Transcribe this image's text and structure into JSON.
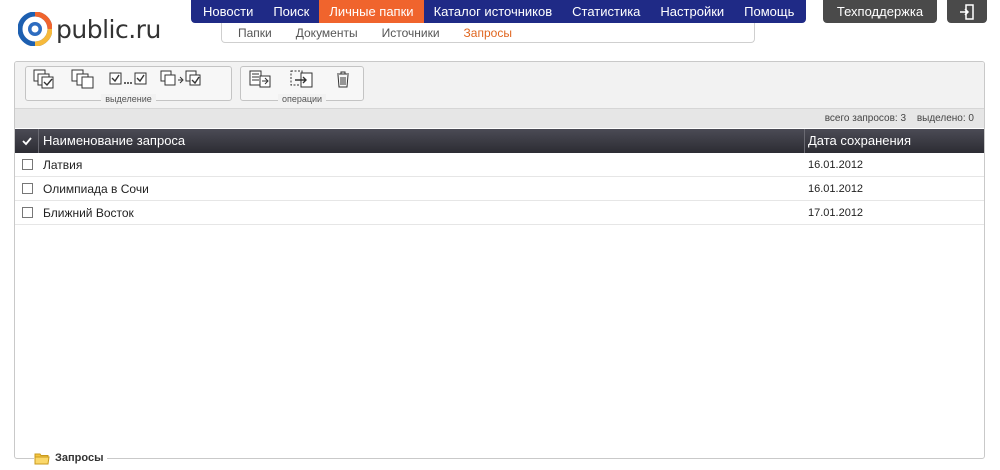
{
  "brand": {
    "name": "public.ru"
  },
  "main_nav": [
    {
      "label": "Новости"
    },
    {
      "label": "Поиск"
    },
    {
      "label": "Личные папки",
      "active": true
    },
    {
      "label": "Каталог источников"
    },
    {
      "label": "Статистика"
    },
    {
      "label": "Настройки"
    },
    {
      "label": "Помощь"
    }
  ],
  "support": {
    "label": "Техподдержка"
  },
  "sub_nav": [
    {
      "label": "Папки"
    },
    {
      "label": "Документы"
    },
    {
      "label": "Источники"
    },
    {
      "label": "Запросы",
      "active": true
    }
  ],
  "toolbar": {
    "selection_group_label": "выделение",
    "operations_group_label": "операции"
  },
  "status": {
    "total": "всего запросов: 3",
    "selected": "выделено: 0"
  },
  "table": {
    "columns": {
      "name": "Наименование запроса",
      "date": "Дата сохранения"
    },
    "rows": [
      {
        "name": "Латвия",
        "date": "16.01.2012"
      },
      {
        "name": "Олимпиада в Сочи",
        "date": "16.01.2012"
      },
      {
        "name": "Ближний Восток",
        "date": "17.01.2012"
      }
    ]
  },
  "footer": {
    "folder_label": "Запросы"
  },
  "colors": {
    "nav_bg": "#1f2a86",
    "nav_active": "#f0642d",
    "sub_active": "#e0661f",
    "header_dark": "#4a4a4a"
  }
}
